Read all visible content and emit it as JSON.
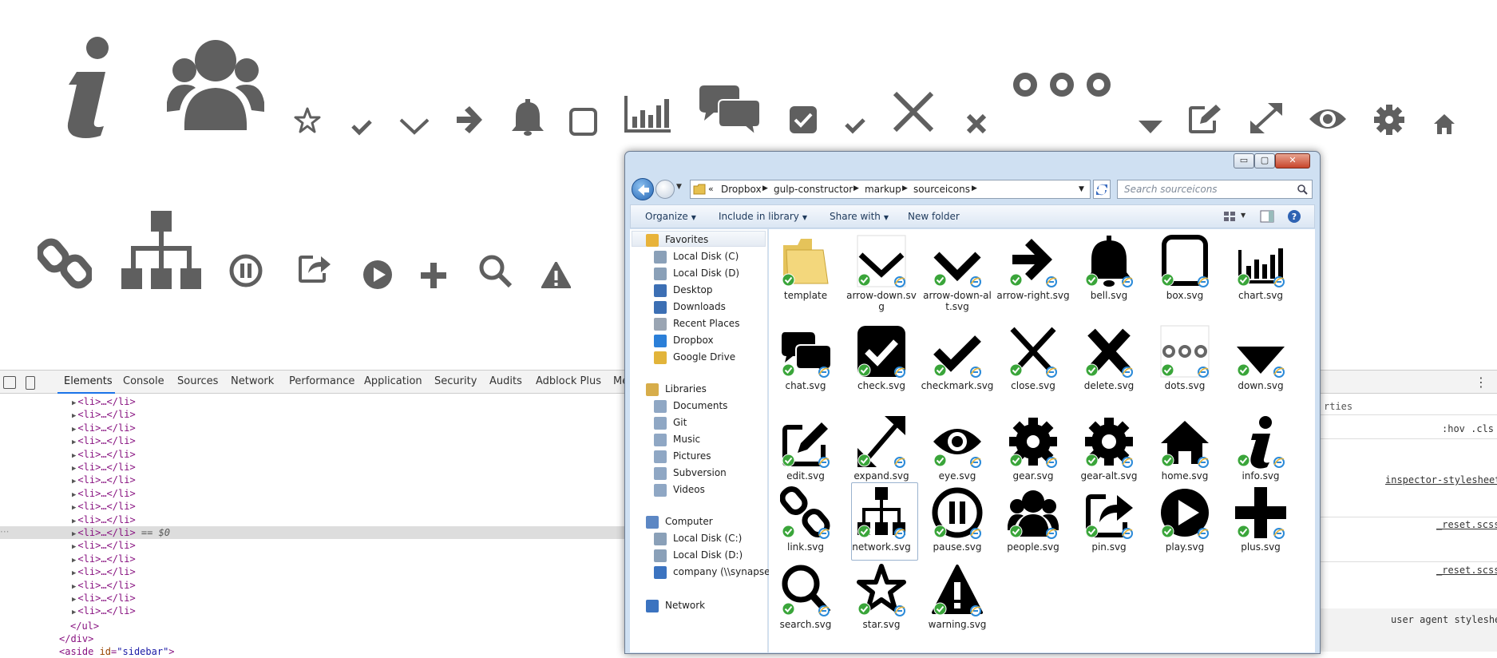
{
  "top_icons": [
    {
      "name": "info-icon"
    },
    {
      "name": "people-icon"
    },
    {
      "name": "star-icon"
    },
    {
      "name": "checkmark-small-icon"
    },
    {
      "name": "arrow-down-icon"
    },
    {
      "name": "arrow-right-icon"
    },
    {
      "name": "bell-icon"
    },
    {
      "name": "box-icon"
    },
    {
      "name": "chart-icon"
    },
    {
      "name": "chat-icon"
    },
    {
      "name": "check-icon"
    },
    {
      "name": "checkmark-icon"
    },
    {
      "name": "close-icon"
    },
    {
      "name": "delete-icon"
    },
    {
      "name": "dots-icon"
    },
    {
      "name": "down-icon"
    },
    {
      "name": "edit-icon"
    },
    {
      "name": "expand-icon"
    },
    {
      "name": "eye-icon"
    },
    {
      "name": "gear-icon"
    },
    {
      "name": "home-icon"
    },
    {
      "name": "link-icon"
    },
    {
      "name": "network-icon"
    },
    {
      "name": "pause-icon"
    },
    {
      "name": "pin-icon"
    },
    {
      "name": "play-icon"
    },
    {
      "name": "plus-icon"
    },
    {
      "name": "search-icon"
    },
    {
      "name": "warning-icon"
    }
  ],
  "icon_color": "#5f5f5f",
  "devtools": {
    "tabs": [
      "Elements",
      "Console",
      "Sources",
      "Network",
      "Performance",
      "Application",
      "Security",
      "Audits",
      "Adblock Plus",
      "Me"
    ],
    "active_tab": "Elements",
    "li_text": "<li>…</li>",
    "selected_suffix": " == $0",
    "close_ul": "</ul>",
    "close_div": "</div>",
    "aside_tag": "<aside ",
    "aside_attr": "id",
    "aside_val": "\"sidebar\"",
    "aside_close": ">",
    "styles": {
      "partial_tab": "rties",
      "hov_cls": ":hov  .cls",
      "src_inspector": "inspector-stylesheet",
      "src_reset_1": "_reset.scss",
      "src_reset_2": "_reset.scss",
      "user_agent": "user agent styleshe"
    }
  },
  "explorer": {
    "controls": {
      "minimize": "▭",
      "maximize": "▢",
      "close": "✕"
    },
    "breadcrumbs": [
      "Dropbox",
      "gulp-constructor",
      "markup",
      "sourceicons"
    ],
    "search_placeholder": "Search sourceicons",
    "commands": {
      "organize": "Organize",
      "include": "Include in library",
      "share": "Share with",
      "new_folder": "New folder"
    },
    "nav": {
      "favorites": "Favorites",
      "fav_items": [
        "Local Disk (C)",
        "Local Disk (D)",
        "Desktop",
        "Downloads",
        "Recent Places",
        "Dropbox",
        "Google Drive"
      ],
      "libraries": "Libraries",
      "lib_items": [
        "Documents",
        "Git",
        "Music",
        "Pictures",
        "Subversion",
        "Videos"
      ],
      "computer": "Computer",
      "comp_items": [
        "Local Disk (C:)",
        "Local Disk (D:)",
        "company (\\\\synapse.c"
      ],
      "network": "Network"
    },
    "files": [
      {
        "name": "template",
        "icon": "folder-icon"
      },
      {
        "name": "arrow-down.svg",
        "icon": "arrow-down-icon"
      },
      {
        "name": "arrow-down-alt.svg",
        "icon": "arrow-down-alt-icon"
      },
      {
        "name": "arrow-right.svg",
        "icon": "arrow-right-icon"
      },
      {
        "name": "bell.svg",
        "icon": "bell-icon"
      },
      {
        "name": "box.svg",
        "icon": "box-icon"
      },
      {
        "name": "chart.svg",
        "icon": "chart-icon"
      },
      {
        "name": "chat.svg",
        "icon": "chat-icon"
      },
      {
        "name": "check.svg",
        "icon": "check-icon"
      },
      {
        "name": "checkmark.svg",
        "icon": "checkmark-icon"
      },
      {
        "name": "close.svg",
        "icon": "close-icon"
      },
      {
        "name": "delete.svg",
        "icon": "delete-icon"
      },
      {
        "name": "dots.svg",
        "icon": "dots-icon"
      },
      {
        "name": "down.svg",
        "icon": "down-icon"
      },
      {
        "name": "edit.svg",
        "icon": "edit-icon"
      },
      {
        "name": "expand.svg",
        "icon": "expand-icon"
      },
      {
        "name": "eye.svg",
        "icon": "eye-icon"
      },
      {
        "name": "gear.svg",
        "icon": "gear-icon"
      },
      {
        "name": "gear-alt.svg",
        "icon": "gear-alt-icon"
      },
      {
        "name": "home.svg",
        "icon": "home-icon"
      },
      {
        "name": "info.svg",
        "icon": "info-icon"
      },
      {
        "name": "link.svg",
        "icon": "link-icon"
      },
      {
        "name": "network.svg",
        "icon": "network-icon",
        "selected": true
      },
      {
        "name": "pause.svg",
        "icon": "pause-icon"
      },
      {
        "name": "people.svg",
        "icon": "people-icon"
      },
      {
        "name": "pin.svg",
        "icon": "pin-icon"
      },
      {
        "name": "play.svg",
        "icon": "play-icon"
      },
      {
        "name": "plus.svg",
        "icon": "plus-icon"
      },
      {
        "name": "search.svg",
        "icon": "search-icon"
      },
      {
        "name": "star.svg",
        "icon": "star-icon"
      },
      {
        "name": "warning.svg",
        "icon": "warning-icon"
      }
    ]
  }
}
